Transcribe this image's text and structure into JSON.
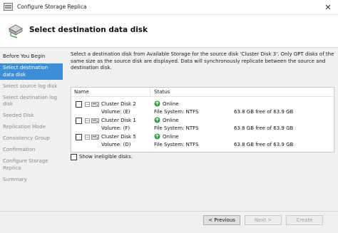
{
  "window": {
    "title": "Configure Storage Replica",
    "close_glyph": "✕"
  },
  "header": {
    "title": "Select destination data disk"
  },
  "nav": {
    "items": [
      {
        "label": "Before You Begin",
        "state": "done"
      },
      {
        "label": "Select destination data disk",
        "state": "active"
      },
      {
        "label": "Select source log disk",
        "state": "pending"
      },
      {
        "label": "Select destination log disk",
        "state": "pending"
      },
      {
        "label": "Seeded Disk",
        "state": "pending"
      },
      {
        "label": "Replication Mode",
        "state": "pending"
      },
      {
        "label": "Consistency Group",
        "state": "pending"
      },
      {
        "label": "Confirmation",
        "state": "pending"
      },
      {
        "label": "Configure Storage Replica",
        "state": "pending"
      },
      {
        "label": "Summary",
        "state": "pending"
      }
    ]
  },
  "main": {
    "description": "Select a destination disk from Available Storage for the source disk 'Cluster Disk 3'. Only GPT disks of the same size as the source disk are displayed. Data will synchronously replicate between the source and destination disk.",
    "columns": {
      "name": "Name",
      "status": "Status"
    },
    "disks": [
      {
        "name": "Cluster Disk 2",
        "status": "Online",
        "volume": "Volume: (E)",
        "fs": "File System: NTFS",
        "free": "63.8 GB free of 63.9 GB"
      },
      {
        "name": "Cluster Disk 1",
        "status": "Online",
        "volume": "Volume: (F)",
        "fs": "File System: NTFS",
        "free": "63.8 GB free of 63.9 GB"
      },
      {
        "name": "Cluster Disk 5",
        "status": "Online",
        "volume": "Volume: (D)",
        "fs": "File System: NTFS",
        "free": "63.8 GB free of 63.9 GB"
      }
    ],
    "show_ineligible_label": "Show ineligible disks."
  },
  "footer": {
    "previous_label": "< Previous",
    "next_label": "Next >",
    "create_label": "Create"
  },
  "colors": {
    "accent": "#3c8fd6",
    "online_green": "#2e9b3e"
  }
}
